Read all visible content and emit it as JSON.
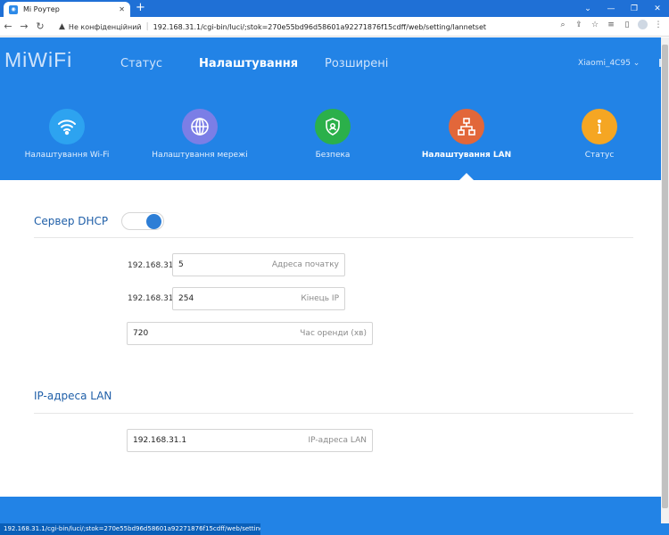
{
  "browser": {
    "tab_title": "Mi Роутер",
    "security_label": "Не конфіденційний",
    "url": "192.168.31.1/cgi-bin/luci/;stok=270e55bd96d58601a92271876f15cdff/web/setting/lannetset",
    "status_url": "192.168.31.1/cgi-bin/luci/;stok=270e55bd96d58601a92271876f15cdff/web/setting/lannetset"
  },
  "header": {
    "logo": "MiWiFi",
    "nav": [
      {
        "label": "Статус",
        "active": false
      },
      {
        "label": "Налаштування",
        "active": true
      },
      {
        "label": "Розширені",
        "active": false
      }
    ],
    "device_name": "Xiaomi_4C95"
  },
  "categories": [
    {
      "label": "Налаштування Wi-Fi",
      "icon": "wifi-icon",
      "color": "#2da3f0",
      "active": false
    },
    {
      "label": "Налаштування мережі",
      "icon": "globe-icon",
      "color": "#7b7ee6",
      "active": false
    },
    {
      "label": "Безпека",
      "icon": "shield-icon",
      "color": "#2bb04a",
      "active": false
    },
    {
      "label": "Налаштування LAN",
      "icon": "network-icon",
      "color": "#e2673a",
      "active": true
    },
    {
      "label": "Статус",
      "icon": "info-icon",
      "color": "#f5a623",
      "active": false
    }
  ],
  "dhcp": {
    "title": "Сервер DHCP",
    "enabled": true,
    "prefix": "192.168.31.",
    "start": {
      "value": "5",
      "placeholder": "Адреса початку"
    },
    "end": {
      "value": "254",
      "placeholder": "Кінець IP"
    },
    "lease": {
      "value": "720",
      "placeholder": "Час оренди (хв)"
    }
  },
  "lan": {
    "title": "IP-адреса LAN",
    "ip": {
      "value": "192.168.31.1",
      "placeholder": "IP-адреса LAN"
    }
  }
}
